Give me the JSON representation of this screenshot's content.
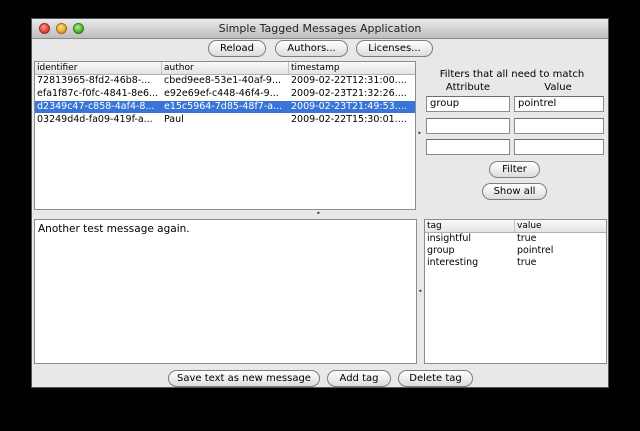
{
  "window": {
    "title": "Simple Tagged Messages Application"
  },
  "toolbar": {
    "reload": "Reload",
    "authors": "Authors...",
    "licenses": "Licenses..."
  },
  "messages": {
    "columns": [
      "identifier",
      "author",
      "timestamp"
    ],
    "rows": [
      [
        "72813965-8fd2-46b8-...",
        "cbed9ee8-53e1-40af-9...",
        "2009-02-22T12:31:00...."
      ],
      [
        "efa1f87c-f0fc-4841-8e6...",
        "e92e69ef-c448-46f4-9...",
        "2009-02-23T21:32:26...."
      ],
      [
        "d2349c47-c858-4af4-8...",
        "e15c5964-7d85-48f7-a...",
        "2009-02-23T21:49:53...."
      ],
      [
        "03249d4d-fa09-419f-a...",
        "Paul",
        "2009-02-22T15:30:01...."
      ]
    ],
    "selected_index": 2
  },
  "filters": {
    "heading": "Filters that all need to match",
    "attr_header": "Attribute",
    "value_header": "Value",
    "rows": [
      {
        "attribute": "group",
        "value": "pointrel"
      },
      {
        "attribute": "",
        "value": ""
      },
      {
        "attribute": "",
        "value": ""
      }
    ],
    "filter_button": "Filter",
    "show_all_button": "Show all"
  },
  "message_text": "Another test message again.",
  "tags": {
    "columns": [
      "tag",
      "value"
    ],
    "rows": [
      [
        "insightful",
        "true"
      ],
      [
        "group",
        "pointrel"
      ],
      [
        "interesting",
        "true"
      ]
    ]
  },
  "bottom": {
    "save": "Save text as new message",
    "add_tag": "Add tag",
    "delete_tag": "Delete tag"
  }
}
